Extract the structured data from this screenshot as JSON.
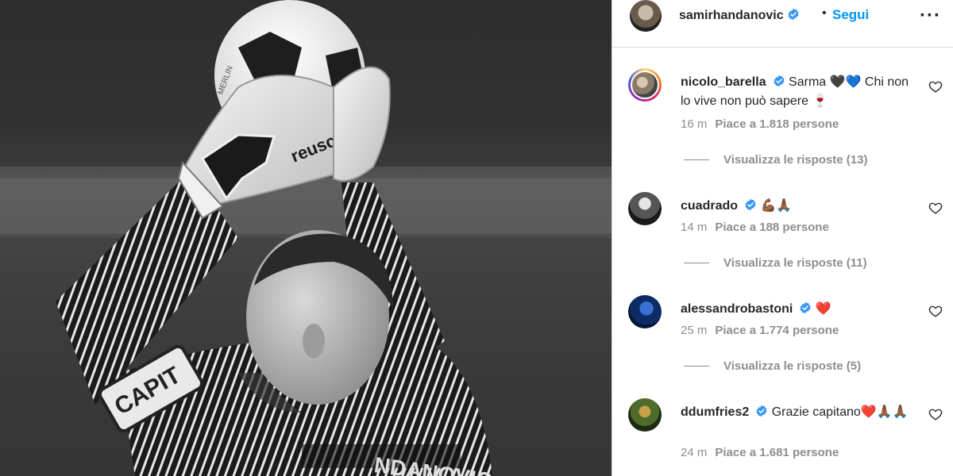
{
  "post": {
    "author": "samirhandanovic",
    "follow_label": "Segui",
    "separator": "•",
    "more_label": "···",
    "photo": {
      "ball_text": "MERLIN",
      "glove_brand": "reusch",
      "armband_text": "CAPIT",
      "shirt_text": "NDANOVIC"
    }
  },
  "comments": [
    {
      "username": "nicolo_barella",
      "text": "Sarma 🖤💙 Chi non lo vive non può sapere 🍷",
      "time": "16 m",
      "likes": "Piace a 1.818 persone",
      "replies": "Visualizza le risposte (13)",
      "avatar_icon": "avatar-photo",
      "story_ring": true
    },
    {
      "username": "cuadrado",
      "text": "💪🏾🙏🏾",
      "time": "14 m",
      "likes": "Piace a 188 persone",
      "replies": "Visualizza le risposte (11)",
      "avatar_icon": "avatar-photo",
      "story_ring": false
    },
    {
      "username": "alessandrobastoni",
      "text": "❤️",
      "time": "25 m",
      "likes": "Piace a 1.774 persone",
      "replies": "Visualizza le risposte (5)",
      "avatar_icon": "avatar-photo",
      "story_ring": false
    },
    {
      "username": "ddumfries2",
      "text": "Grazie capitano❤️🙏🏾🙏🏾",
      "time": "24 m",
      "likes": "Piace a 1.681 persone",
      "replies": "",
      "avatar_icon": "avatar-photo",
      "story_ring": false
    }
  ],
  "colors": {
    "accent": "#0095f6",
    "verified": "#3897f0",
    "secondary_text": "#8e8e8e",
    "border": "#dbdbdb"
  }
}
